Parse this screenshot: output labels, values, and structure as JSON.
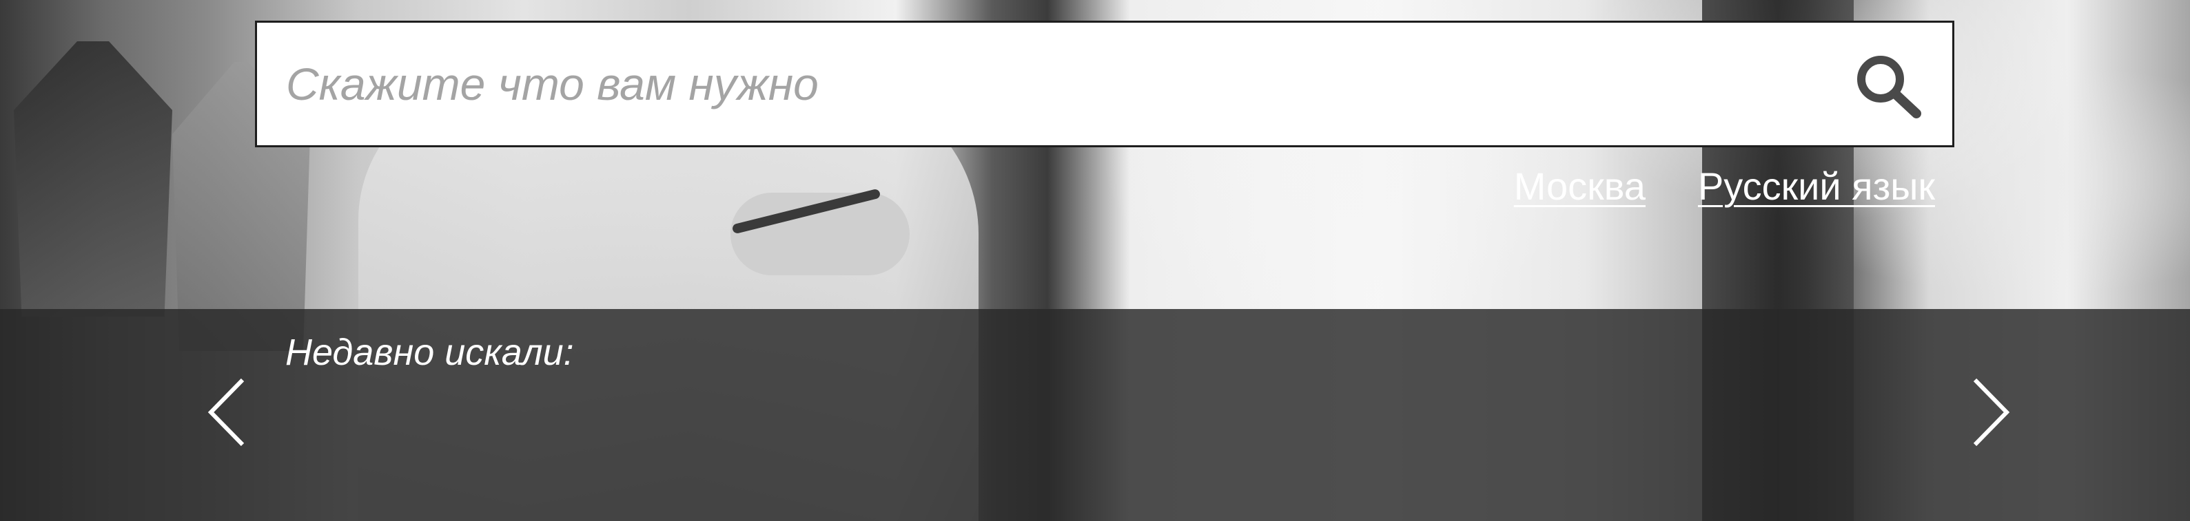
{
  "search": {
    "placeholder": "Скажите что вам нужно",
    "button_icon": "search-icon"
  },
  "links": {
    "city": "Москва",
    "language": "Русский язык"
  },
  "recent": {
    "label": "Недавно искали:",
    "prev_icon": "chevron-left-icon",
    "next_icon": "chevron-right-icon"
  },
  "colors": {
    "search_background": "#ffffff",
    "placeholder_text": "#a4a4a4",
    "icon": "#4a4a4a",
    "panel_overlay": "#282828",
    "link_text": "#ffffff"
  }
}
